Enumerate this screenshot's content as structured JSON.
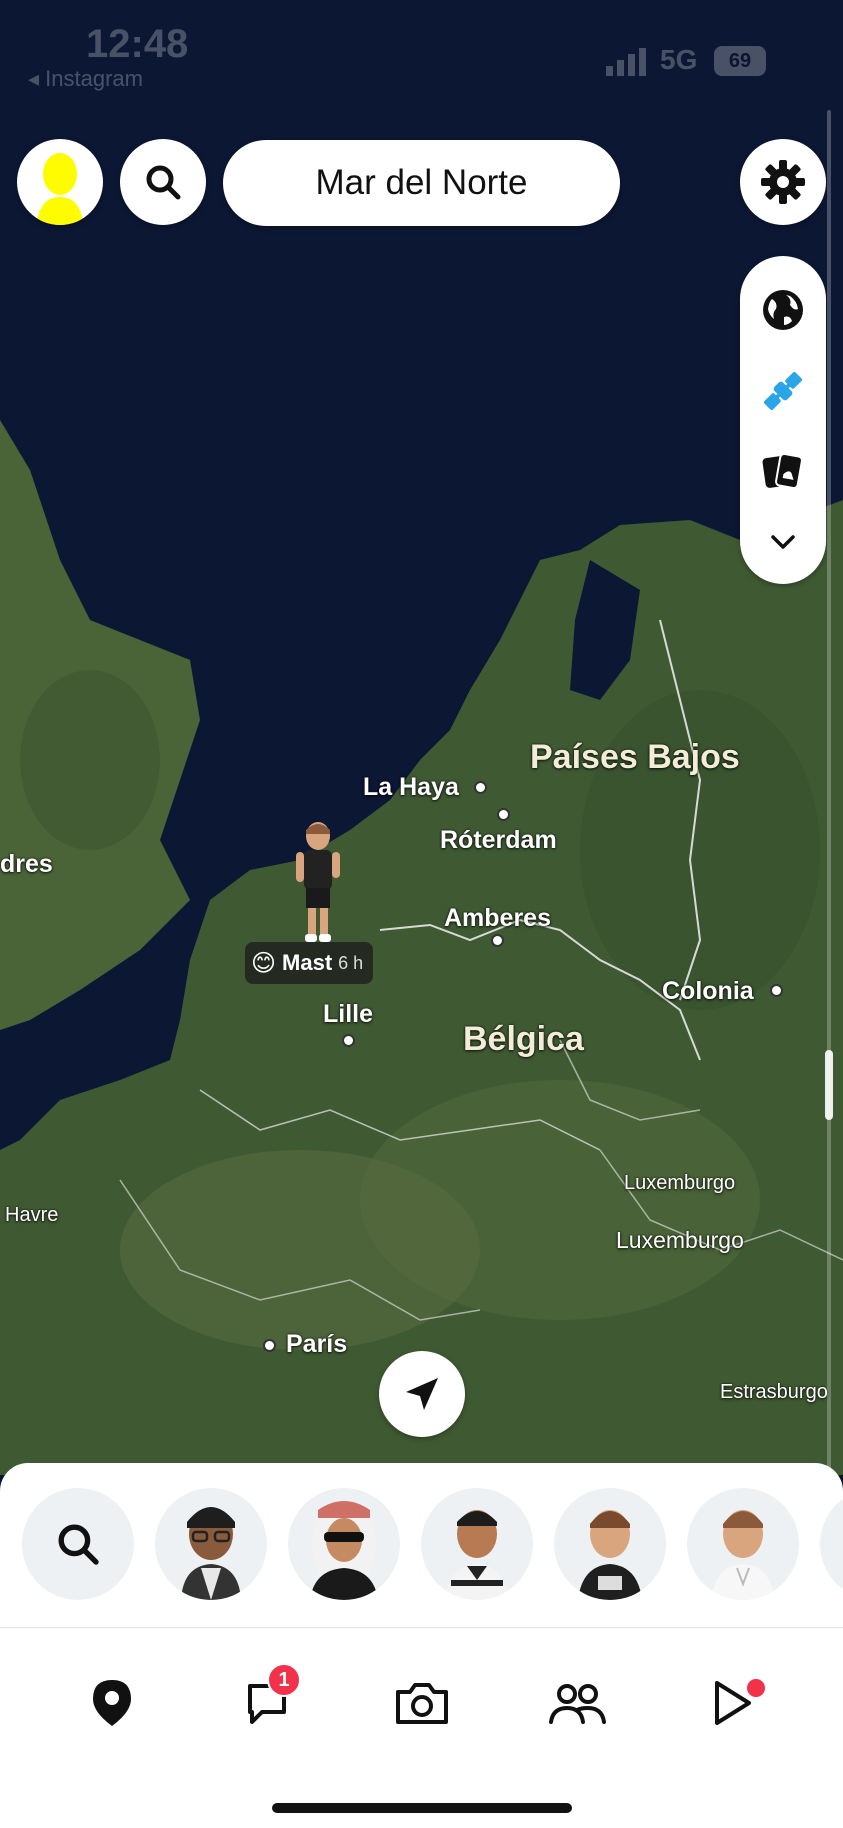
{
  "status_bar": {
    "time": "12:48",
    "back_app": "Instagram",
    "network": "5G",
    "battery": "69"
  },
  "header": {
    "location_title": "Mar del Norte"
  },
  "layers": [
    "globe-icon",
    "satellite-icon",
    "memories-icon",
    "chevron-down-icon"
  ],
  "map": {
    "labels": {
      "paises_bajos": "Países Bajos",
      "la_haya": "La Haya",
      "roterdam": "Róterdam",
      "amberes": "Amberes",
      "londres": "dres",
      "lille": "Lille",
      "belgica": "Bélgica",
      "colonia": "Colonia",
      "luxemburgo_region": "Luxemburgo",
      "luxemburgo_city": "Luxemburgo",
      "havre": "Havre",
      "paris": "París",
      "estrasburgo": "Estrasburgo"
    },
    "friend": {
      "emoji": "😊",
      "name": "Mast",
      "ago": "6 h"
    }
  },
  "sheet": {
    "friend_avatars": [
      "friend-1",
      "friend-2",
      "friend-3",
      "friend-4",
      "friend-5"
    ]
  },
  "tabbar": {
    "chat_badge": "1"
  },
  "colors": {
    "accent_yellow": "#FFFC00",
    "badge_red": "#F2314A",
    "satellite_blue": "#2aa6e8"
  }
}
